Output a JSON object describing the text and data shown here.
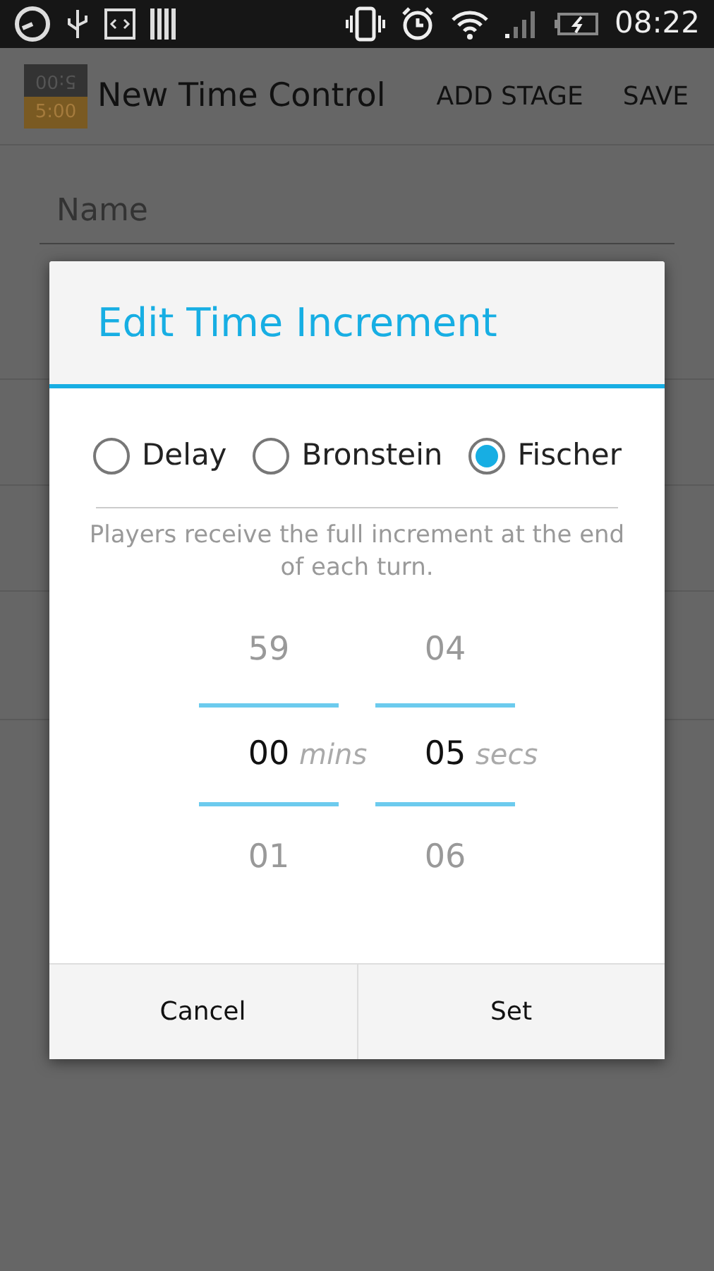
{
  "status_bar": {
    "time": "08:22"
  },
  "action_bar": {
    "logo": {
      "top": "5:00",
      "bottom": "5:00"
    },
    "title": "New Time Control",
    "actions": [
      "ADD STAGE",
      "SAVE"
    ]
  },
  "form": {
    "name_field": {
      "placeholder": "Name"
    }
  },
  "dialog": {
    "title": "Edit Time Increment",
    "modes": [
      {
        "label": "Delay",
        "selected": false
      },
      {
        "label": "Bronstein",
        "selected": false
      },
      {
        "label": "Fischer",
        "selected": true
      }
    ],
    "description": "Players receive the full increment at the end of each turn.",
    "pickers": [
      {
        "above": "59",
        "value": "00",
        "unit": "mins",
        "below": "01"
      },
      {
        "above": "04",
        "value": "05",
        "unit": "secs",
        "below": "06"
      }
    ],
    "buttons": [
      "Cancel",
      "Set"
    ]
  }
}
